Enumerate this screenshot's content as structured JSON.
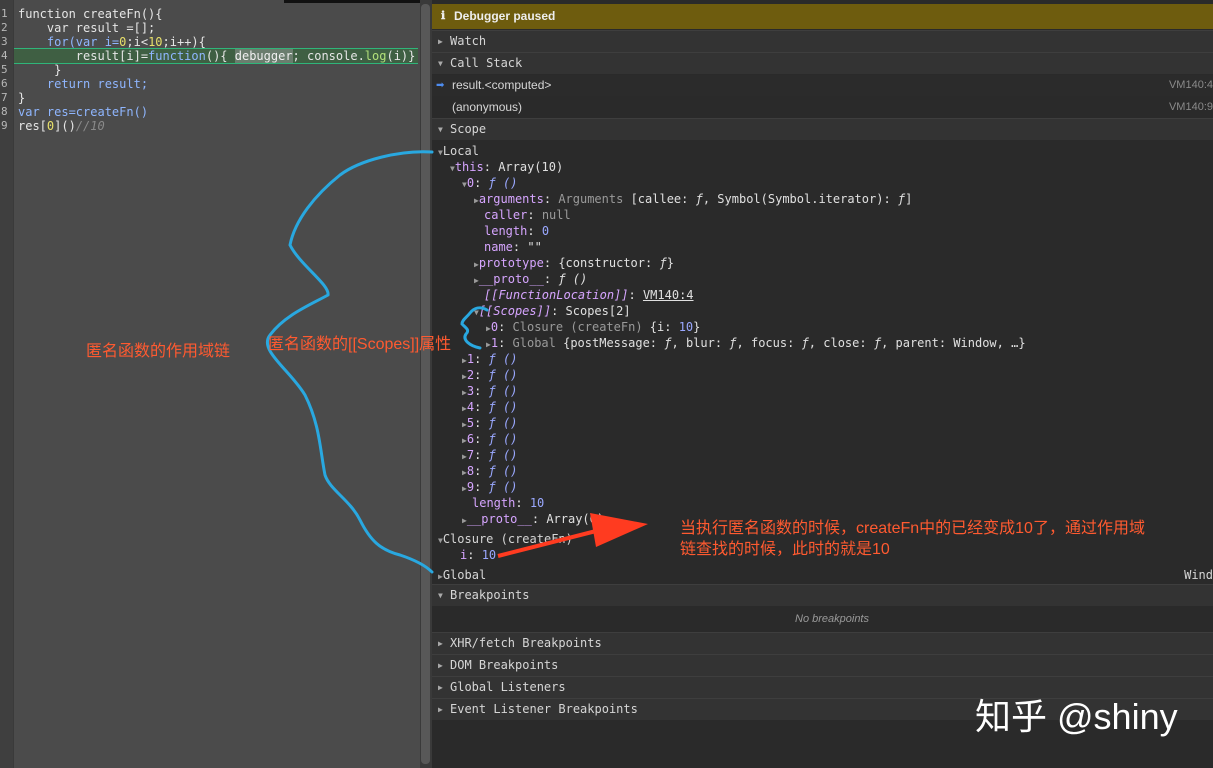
{
  "editor": {
    "line_numbers": [
      "1",
      "2",
      "3",
      "4",
      "5",
      "6",
      "7",
      "8",
      "9"
    ],
    "lines": {
      "l1": "function createFn(){",
      "l2": "    var result =[];",
      "l3a": "    for(var i=",
      "l3b": "0",
      "l3c": ";i<",
      "l3d": "10",
      "l3e": ";i++){",
      "l4a": "        result[i]=",
      "l4b": "function",
      "l4c": "(){ ",
      "l4d": "debugger",
      "l4e": "; console.",
      "l4f": "log",
      "l4g": "(i)}",
      "l5": "     }",
      "l6": "    return result;",
      "l7": "}",
      "l8": "var res=createFn()",
      "l9a": "res[",
      "l9b": "0",
      "l9c": "]()",
      "l9d": "//10"
    }
  },
  "debugger": {
    "paused_label": "Debugger paused",
    "paused_icon": "info-icon",
    "sections": {
      "watch": "Watch",
      "call_stack": "Call Stack",
      "scope": "Scope",
      "breakpoints": "Breakpoints",
      "no_breakpoints": "No breakpoints",
      "xhr": "XHR/fetch Breakpoints",
      "dom": "DOM Breakpoints",
      "global_listeners": "Global Listeners",
      "event_listener": "Event Listener Breakpoints"
    },
    "call_stack": [
      {
        "name": "result.<computed>",
        "loc": "VM140:4"
      },
      {
        "name": "(anonymous)",
        "loc": "VM140:9"
      }
    ],
    "scope": {
      "local": "Local",
      "this_key": "this",
      "this_val": "Array(10)",
      "item0_key": "0",
      "f": "ƒ",
      "paren": "()",
      "arguments_key": "arguments",
      "arguments_val_a": "Arguments",
      "arguments_val_b": "[callee: ",
      "arguments_val_c": ", Symbol(Symbol.iterator): ",
      "arguments_val_d": "]",
      "caller_key": "caller",
      "caller_val": "null",
      "length_key": "length",
      "length_val": "0",
      "name_key": "name",
      "name_val": "\"\"",
      "prototype_key": "prototype",
      "prototype_val": "{constructor: ",
      "prototype_end": "}",
      "proto_key": "__proto__",
      "fnloc_key": "[[FunctionLocation]]",
      "fnloc_val": "VM140:4",
      "scopes_key": "[[Scopes]]",
      "scopes_val": "Scopes[2]",
      "scope0_key": "0",
      "scope0_a": "Closure (createFn)",
      "scope0_b": "{i: ",
      "scope0_num": "10",
      "scope0_c": "}",
      "scope1_key": "1",
      "scope1_a": "Global",
      "scope1_b": "{postMessage: ",
      "scope1_c": ", blur: ",
      "scope1_d": ", focus: ",
      "scope1_e": ", close: ",
      "scope1_f": ", parent: Window, …}",
      "items": [
        "1",
        "2",
        "3",
        "4",
        "5",
        "6",
        "7",
        "8",
        "9"
      ],
      "arr_length_key": "length",
      "arr_length_val": "10",
      "arr_proto_key": "__proto__",
      "arr_proto_val": "Array(0)",
      "closure": "Closure (createFn)",
      "closure_i_key": "i",
      "closure_i_val": "10",
      "global": "Global",
      "global_val": "Wind"
    }
  },
  "annotations": {
    "left": "匿名函数的作用域链",
    "middle": "匿名函数的[[Scopes]]属性",
    "right_line1": "当执行匿名函数的时候，createFn中的已经变成10了，通过作用域",
    "right_line2": "链查找的时候，此时的就是10"
  },
  "watermark": "知乎 @shiny",
  "colors": {
    "annotation": "#ff5a30",
    "curve": "#29a8e0",
    "paused_bar": "#6e5c0e"
  }
}
